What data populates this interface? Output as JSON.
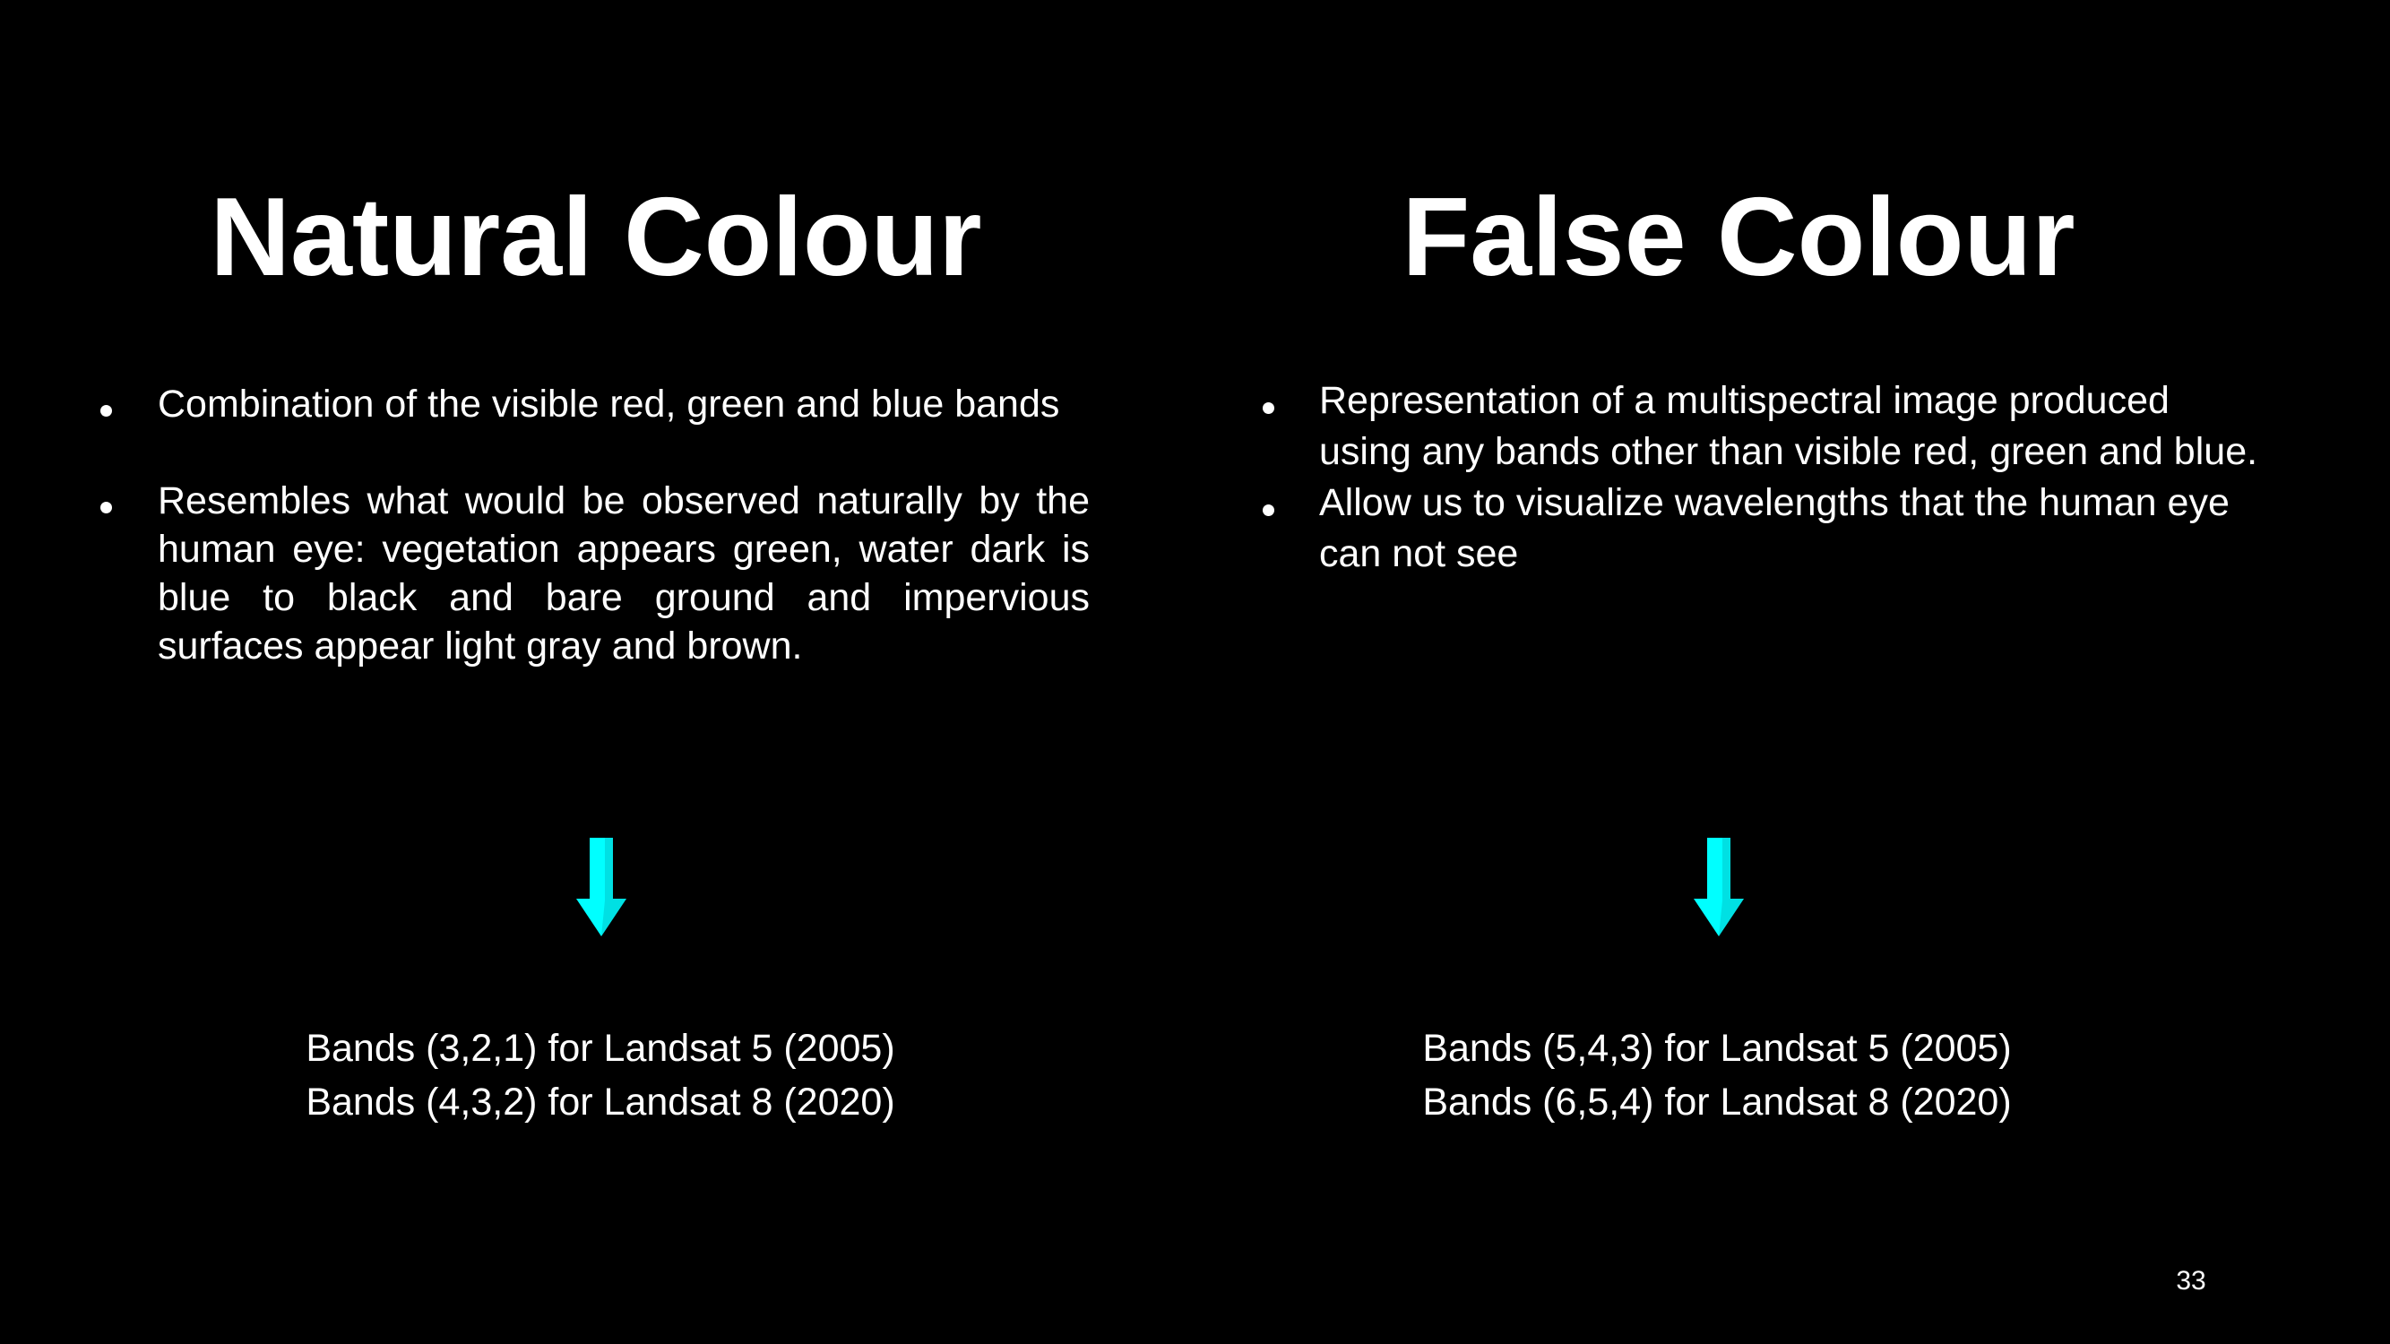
{
  "left": {
    "title": "Natural Colour",
    "bullets": [
      "Combination of the visible red, green and blue bands",
      "Resembles what would be observed naturally by the human eye: vegetation appears green, water dark is blue to black and bare ground and impervious surfaces appear light gray and brown."
    ],
    "arrow_icon": "down-arrow-icon",
    "bands": [
      "Bands (3,2,1) for Landsat 5 (2005)",
      "Bands (4,3,2) for Landsat 8 (2020)"
    ]
  },
  "right": {
    "title": "False Colour",
    "bullets": [
      "Representation of a multispectral image produced using any bands other than visible red, green and blue.",
      "Allow us to visualize wavelengths that the human eye can not see"
    ],
    "arrow_icon": "down-arrow-icon",
    "bands": [
      "Bands (5,4,3) for Landsat 5 (2005)",
      "Bands (6,5,4) for Landsat 8 (2020)"
    ]
  },
  "page_number": "33",
  "colors": {
    "background": "#000000",
    "text": "#ffffff",
    "arrow_fill": "#00ffff",
    "arrow_shade": "#00a8b0"
  }
}
